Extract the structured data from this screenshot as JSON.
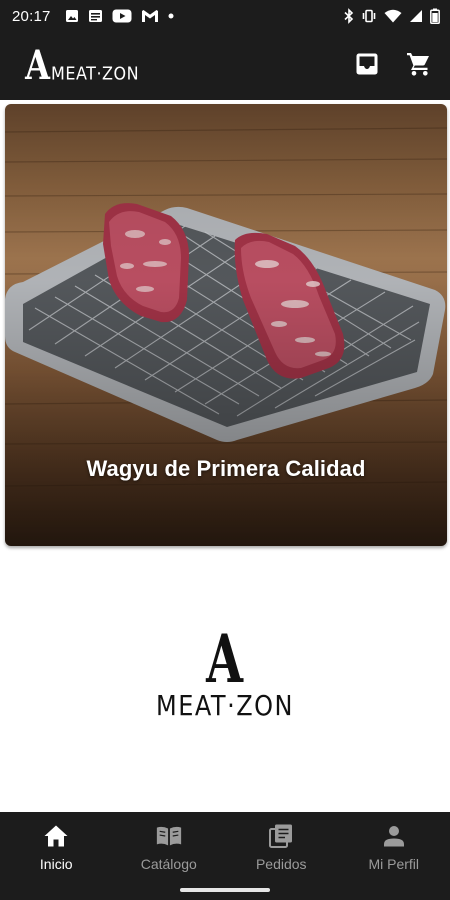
{
  "status_bar": {
    "time": "20:17",
    "left_icons": [
      "image-icon",
      "news-icon",
      "youtube-icon",
      "gmail-icon",
      "dot-icon"
    ],
    "right_icons": [
      "bluetooth-icon",
      "vibrate-icon",
      "wifi-icon",
      "signal-icon",
      "battery-icon"
    ]
  },
  "app_bar": {
    "logo_letter": "A",
    "logo_word": "MEAT·ZON",
    "actions": [
      "inbox-icon",
      "cart-icon"
    ]
  },
  "hero": {
    "caption": "Wagyu de Primera Calidad"
  },
  "center_logo": {
    "letter": "A",
    "word": "MEAT·ZON"
  },
  "bottom_nav": {
    "items": [
      {
        "label": "Inicio",
        "icon": "home-icon",
        "active": true
      },
      {
        "label": "Catálogo",
        "icon": "book-icon",
        "active": false
      },
      {
        "label": "Pedidos",
        "icon": "orders-icon",
        "active": false
      },
      {
        "label": "Mi Perfil",
        "icon": "person-icon",
        "active": false
      }
    ]
  },
  "colors": {
    "bar_background": "#1c1c1c",
    "active_nav": "#ffffff",
    "inactive_nav": "#9b9b9b"
  }
}
